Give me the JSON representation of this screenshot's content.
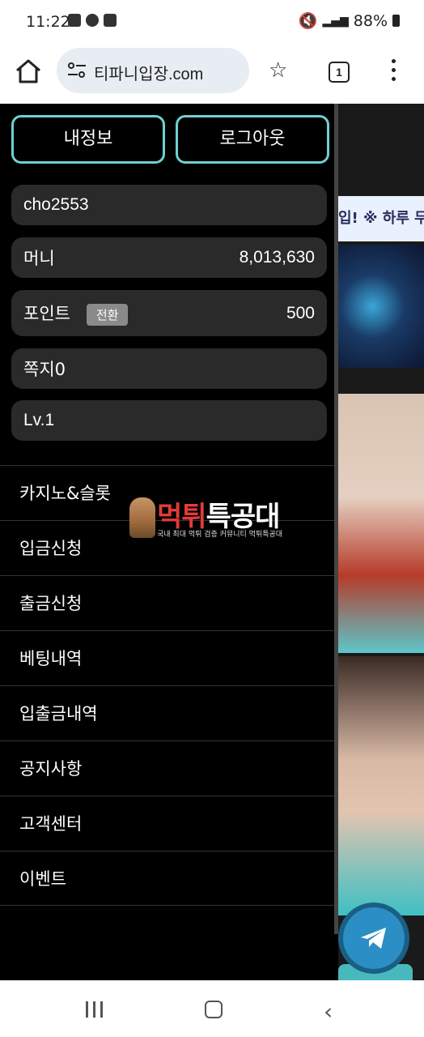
{
  "status_bar": {
    "time": "11:22",
    "battery": "88%"
  },
  "browser": {
    "url": "티파니입장.com",
    "tab_count": "1"
  },
  "drawer": {
    "buttons": {
      "my_info": "내정보",
      "logout": "로그아웃"
    },
    "account": {
      "username": "cho2553",
      "money_label": "머니",
      "money_value": "8,013,630",
      "points_label": "포인트",
      "points_convert": "전환",
      "points_value": "500",
      "messages": "쪽지0",
      "level": "Lv.1"
    },
    "menu": [
      "카지노&슬롯",
      "입금신청",
      "출금신청",
      "베팅내역",
      "입출금내역",
      "공지사항",
      "고객센터",
      "이벤트"
    ]
  },
  "watermark": {
    "logo_prefix": "먹튀",
    "logo_suffix": "특공대",
    "tagline": "국내 최대 먹튀 검증 커뮤니티 먹튀특공대"
  },
  "background_page": {
    "ticker": "입! ※ 하루 무"
  }
}
